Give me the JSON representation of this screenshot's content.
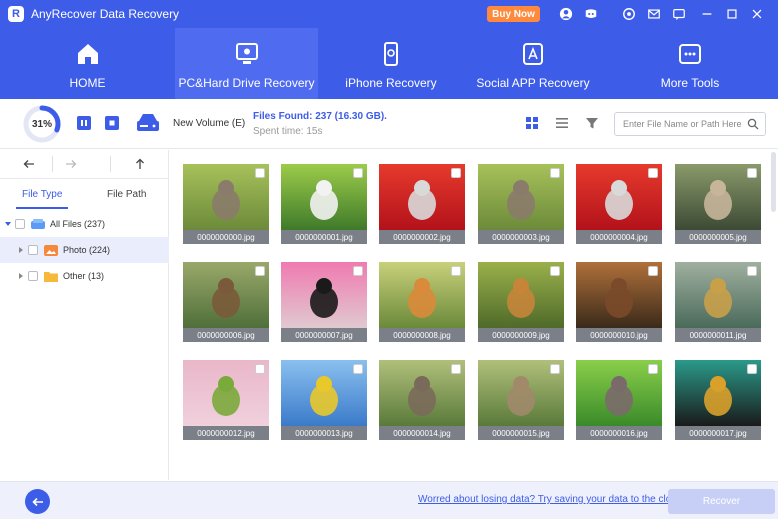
{
  "app": {
    "title": "AnyRecover Data Recovery",
    "logo_letter": "R",
    "buy_label": "Buy Now"
  },
  "nav": {
    "items": [
      {
        "label": "HOME",
        "icon": "home-icon"
      },
      {
        "label": "PC&Hard Drive Recovery",
        "icon": "hard-drive-icon",
        "active": true
      },
      {
        "label": "iPhone Recovery",
        "icon": "iphone-icon"
      },
      {
        "label": "Social APP Recovery",
        "icon": "app-store-icon"
      },
      {
        "label": "More Tools",
        "icon": "more-tools-icon"
      }
    ]
  },
  "scan": {
    "progress_label": "31%",
    "progress": 0.31,
    "volume": "New Volume (E)",
    "found": "Files Found: 237 (16.30 GB).",
    "spent": "Spent time: 15s"
  },
  "search": {
    "placeholder": "Enter File Name or Path Here"
  },
  "sidebar": {
    "tabs": [
      "File Type",
      "File Path"
    ],
    "tree": [
      {
        "label": "All Files (237)"
      },
      {
        "label": "Photo (224)"
      },
      {
        "label": "Other (13)"
      }
    ]
  },
  "files": [
    "0000000000.jpg",
    "0000000001.jpg",
    "0000000002.jpg",
    "0000000003.jpg",
    "0000000004.jpg",
    "0000000005.jpg",
    "0000000006.jpg",
    "0000000007.jpg",
    "0000000008.jpg",
    "0000000009.jpg",
    "0000000010.jpg",
    "0000000011.jpg",
    "0000000012.jpg",
    "0000000013.jpg",
    "0000000014.jpg",
    "0000000015.jpg",
    "0000000016.jpg",
    "0000000017.jpg"
  ],
  "bottom": {
    "cloud_link": "Worred about losing data? Try saving your data to the cloud",
    "recover_label": "Recover"
  },
  "colors": {
    "accent": "#3d5ce8",
    "buy": "#ff8a3d",
    "recover_disabled": "#c7cff7"
  }
}
